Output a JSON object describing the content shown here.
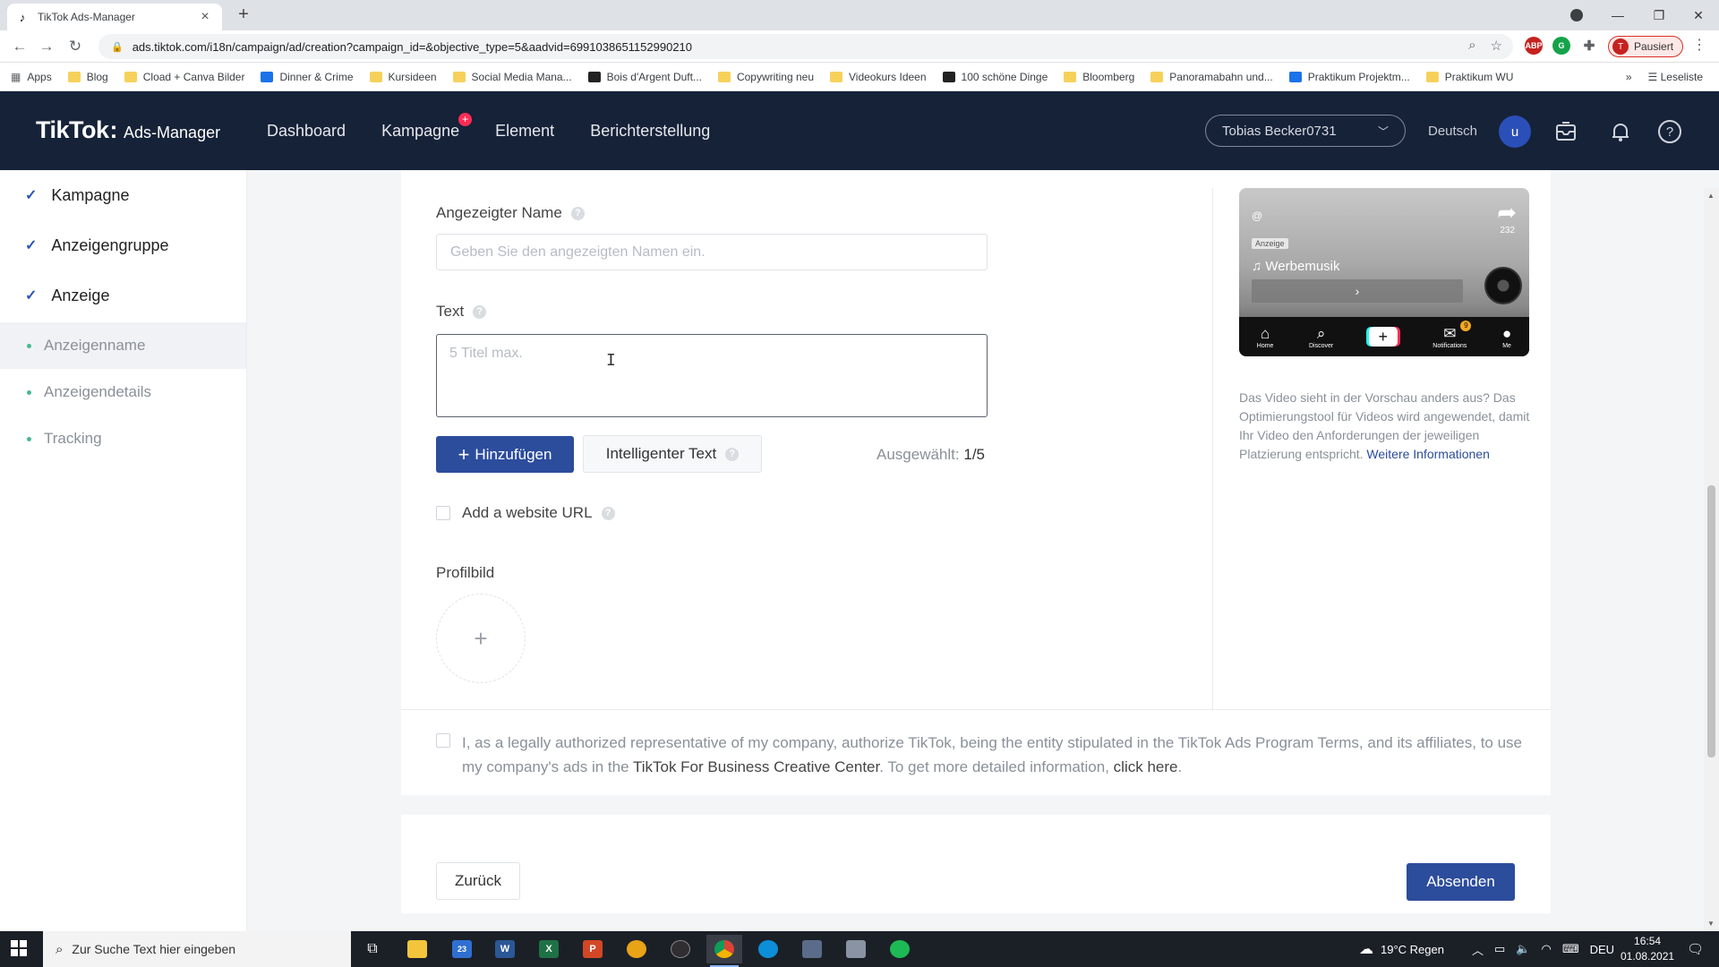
{
  "browser": {
    "tab_title": "TikTok Ads-Manager",
    "url": "ads.tiktok.com/i18n/campaign/ad/creation?campaign_id=&objective_type=5&aadvid=6991038651152990210",
    "profile_status": "Pausiert",
    "profile_initial": "T",
    "bookmarks": [
      {
        "label": "Apps",
        "icon": "grid"
      },
      {
        "label": "Blog",
        "icon": "folder"
      },
      {
        "label": "Cload + Canva Bilder",
        "icon": "folder"
      },
      {
        "label": "Dinner & Crime",
        "icon": "site"
      },
      {
        "label": "Kursideen",
        "icon": "folder"
      },
      {
        "label": "Social Media Mana...",
        "icon": "folder"
      },
      {
        "label": "Bois d'Argent Duft...",
        "icon": "dark"
      },
      {
        "label": "Copywriting neu",
        "icon": "folder"
      },
      {
        "label": "Videokurs Ideen",
        "icon": "folder"
      },
      {
        "label": "100 schöne Dinge",
        "icon": "dark"
      },
      {
        "label": "Bloomberg",
        "icon": "folder"
      },
      {
        "label": "Panoramabahn und...",
        "icon": "folder"
      },
      {
        "label": "Praktikum Projektm...",
        "icon": "site"
      },
      {
        "label": "Praktikum WU",
        "icon": "folder"
      }
    ],
    "reading_list": "Leseliste",
    "more_bookmarks": "»",
    "extensions": {
      "abp": "ABP",
      "grammarly": "G"
    }
  },
  "header": {
    "logo_brand": "TikTok",
    "logo_suffix": ":",
    "logo_product": "Ads-Manager",
    "nav": [
      {
        "label": "Dashboard"
      },
      {
        "label": "Kampagne",
        "badge": "+"
      },
      {
        "label": "Element"
      },
      {
        "label": "Berichterstellung"
      }
    ],
    "account": "Tobias Becker0731",
    "language": "Deutsch",
    "user_initial": "u"
  },
  "sidebar": {
    "steps": [
      {
        "label": "Kampagne"
      },
      {
        "label": "Anzeigengruppe"
      },
      {
        "label": "Anzeige"
      }
    ],
    "substeps": [
      {
        "label": "Anzeigenname",
        "active": true
      },
      {
        "label": "Anzeigendetails",
        "active": false
      },
      {
        "label": "Tracking",
        "active": false
      }
    ]
  },
  "form": {
    "display_name_label": "Angezeigter Name",
    "display_name_placeholder": "Geben Sie den angezeigten Namen ein.",
    "display_name_value": "",
    "text_label": "Text",
    "text_placeholder": "5 Titel max.",
    "add_button": "Hinzufügen",
    "smart_text_button": "Intelligenter Text",
    "selected_prefix": "Ausgewählt:",
    "selected_count": "1/5",
    "website_url_label": "Add a website URL",
    "profile_image_label": "Profilbild",
    "upload_symbol": "+",
    "consent_text_a": "I, as a legally authorized representative of my company, authorize TikTok, being the entity stipulated in the TikTok Ads Program Terms, and its affiliates, to use my company's ads in the ",
    "consent_link_1": "TikTok For Business Creative Center",
    "consent_text_b": ". To get more detailed information, ",
    "consent_link_2": "click here",
    "consent_text_c": "."
  },
  "preview": {
    "handle": "@",
    "ad_tag": "Anzeige",
    "music": "♫ Werbemusik",
    "share_count": "232",
    "cta_arrow": "›",
    "nav": [
      {
        "label": "Home",
        "glyph": "⌂"
      },
      {
        "label": "Discover",
        "glyph": "⌕"
      },
      {
        "label": "",
        "glyph": "+"
      },
      {
        "label": "Notifications",
        "glyph": "✉",
        "badge": "9"
      },
      {
        "label": "Me",
        "glyph": "●"
      }
    ],
    "note": "Das Video sieht in der Vorschau anders aus? Das Optimierungstool für Videos wird angewendet, damit Ihr Video den Anforderungen der jeweiligen Platzierung entspricht. ",
    "note_link": "Weitere Informationen"
  },
  "footer": {
    "back": "Zurück",
    "submit": "Absenden"
  },
  "taskbar": {
    "search_placeholder": "Zur Suche Text hier eingeben",
    "mail_badge": "23",
    "weather": "19°C Regen",
    "input_lang": "DEU",
    "time": "16:54",
    "date": "01.08.2021"
  },
  "colors": {
    "header_bg": "#162238",
    "primary": "#2c4c9c",
    "check": "#2a56b5",
    "dot": "#46b98f",
    "badge": "#fe2c55"
  }
}
